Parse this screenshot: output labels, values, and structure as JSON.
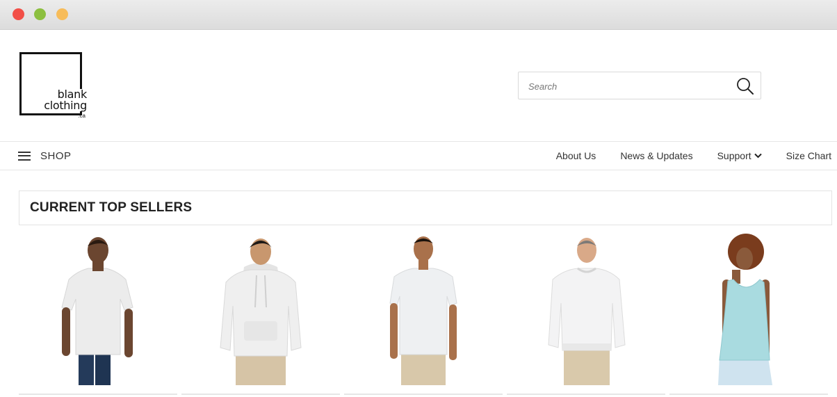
{
  "window": {
    "controls": [
      "close",
      "minimize",
      "maximize"
    ],
    "colors": {
      "close": "#f24f47",
      "minimize": "#8cbf3f",
      "maximize": "#f7bc5a"
    }
  },
  "brand": {
    "logo_line1": "blank",
    "logo_line2": "clothing",
    "logo_suffix": ".ca"
  },
  "search": {
    "placeholder": "Search",
    "value": "",
    "icon": "search-icon"
  },
  "nav": {
    "menu_icon": "hamburger-icon",
    "shop_label": "SHOP",
    "links": [
      {
        "label": "About Us"
      },
      {
        "label": "News & Updates"
      },
      {
        "label": "Support",
        "icon": "chevron-down-icon"
      },
      {
        "label": "Size Chart"
      }
    ]
  },
  "section": {
    "title": "CURRENT TOP SELLERS"
  },
  "products": [
    {
      "image": "man-white-tshirt",
      "garment_color": "#ececec"
    },
    {
      "image": "man-white-hoodie",
      "garment_color": "#efefef"
    },
    {
      "image": "man-white-tshirt-fitted",
      "garment_color": "#eef0f2"
    },
    {
      "image": "man-white-crewneck-sweatshirt",
      "garment_color": "#f3f3f4"
    },
    {
      "image": "woman-light-blue-tank-top",
      "garment_color": "#a9dbe0"
    }
  ]
}
